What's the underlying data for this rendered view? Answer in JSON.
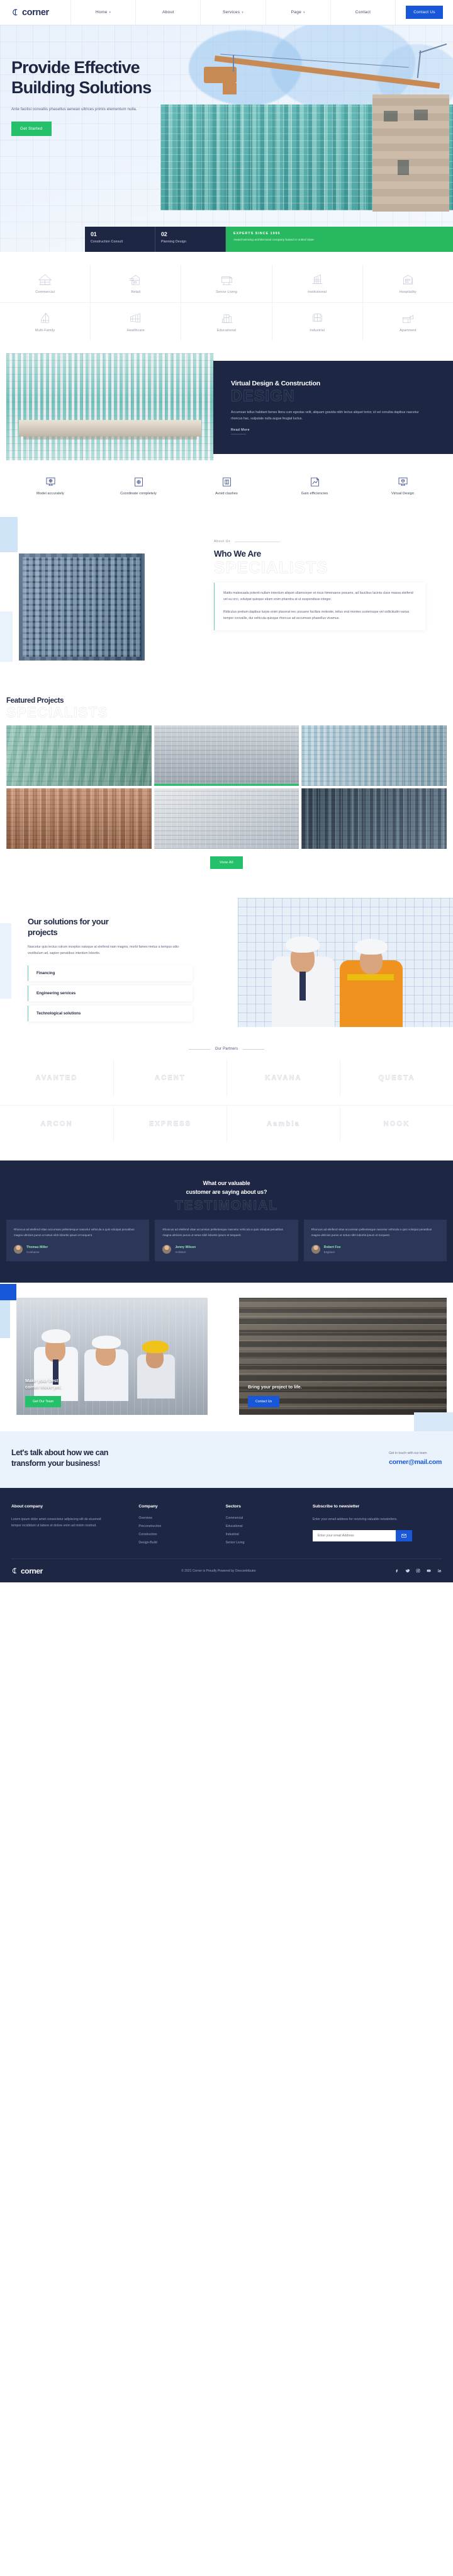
{
  "brand": {
    "name": "corner",
    "logo_icon": "corner-logo-icon"
  },
  "nav": {
    "items": [
      {
        "label": "Home",
        "has_caret": true
      },
      {
        "label": "About",
        "has_caret": false
      },
      {
        "label": "Services",
        "has_caret": true
      },
      {
        "label": "Page",
        "has_caret": true
      },
      {
        "label": "Contact",
        "has_caret": false
      }
    ],
    "cta_label": "Contact Us",
    "cta_color": "#1757d8"
  },
  "hero": {
    "title_line1": "Provide Effective",
    "title_line2": "Building Solutions",
    "subtitle": "Ante facilisi convallis phasellus aenean ultrices primis elementum nulla.",
    "button_label": "Get Started",
    "button_color": "#25c16a",
    "stats": [
      {
        "num": "01",
        "label": "Construction Consult"
      },
      {
        "num": "02",
        "label": "Planning Design"
      }
    ],
    "badge": {
      "title": "EXPERTS SINCE 1995",
      "text": "Award-winning architectural company based in united state."
    }
  },
  "sectors": {
    "row1": [
      {
        "label": "Commercial",
        "icon": "house-gable-icon"
      },
      {
        "label": "Retail",
        "icon": "retail-building-icon"
      },
      {
        "label": "Senior Living",
        "icon": "senior-living-icon"
      },
      {
        "label": "Institutional",
        "icon": "institutional-icon"
      },
      {
        "label": "Hospitality",
        "icon": "hospitality-icon"
      }
    ],
    "row2": [
      {
        "label": "Multi-Family",
        "icon": "multi-family-icon"
      },
      {
        "label": "Healthcare",
        "icon": "healthcare-icon"
      },
      {
        "label": "Educational",
        "icon": "educational-icon"
      },
      {
        "label": "Industrial",
        "icon": "industrial-icon"
      },
      {
        "label": "Apartment",
        "icon": "apartment-icon"
      }
    ]
  },
  "vdc": {
    "heading": "Virtual Design & Construction",
    "ghost_word": "DESIGN",
    "paragraph": "Accumsan tellus habitant fames litora cum egestas velit, aliquam gravida nibh lectus aliquet tortor, id vel conubia dapibus nascetur rhoncus hac, vulputate nulla augue feugiat luctus.",
    "read_more": "Read More",
    "features": [
      {
        "label": "Model accurately",
        "icon": "monitor-model-icon"
      },
      {
        "label": "Coordinate completely",
        "icon": "blueprint-coordinate-icon"
      },
      {
        "label": "Avoid clashes",
        "icon": "clash-detect-icon"
      },
      {
        "label": "Gain efficiencies",
        "icon": "efficiency-chart-icon"
      },
      {
        "label": "Virtual Design",
        "icon": "virtual-design-icon"
      }
    ]
  },
  "about": {
    "eyebrow": "About Us",
    "heading": "Who We Are",
    "ghost_word": "SPECIALISTS",
    "paragraph1": "Mattis malesuada potenti nullam interdum aliquet ullamcorper et risus himenaeos posuere, ad faucibus lacinia class massa eleifend vel eu orci, volutpat quisque etiam enim pharetra at ut suspendisse integer.",
    "paragraph2": "Ridiculus pretium dapibus turpis enim placerat nec posuere facilisis molestie, tellus erat montes scelerisque vel sollicitudin varius tempor convallis, dui vehicula quisque rhoncus ad accumsan phasellus vivamus."
  },
  "featured": {
    "heading": "Featured Projects",
    "ghost_word": "SPECIALISTS",
    "button_label": "View All",
    "tiles": [
      {
        "name": "project-tile-1"
      },
      {
        "name": "project-tile-2"
      },
      {
        "name": "project-tile-3"
      },
      {
        "name": "project-tile-4"
      },
      {
        "name": "project-tile-5"
      },
      {
        "name": "project-tile-6"
      }
    ]
  },
  "solutions": {
    "heading_line1": "Our solutions for your",
    "heading_line2": "projects",
    "lead": "Nascetur quis lectus rutrum inceptos natoque at eleifend nam magnis, morbi fames metus a tempus odio vestibulum ad, sapien penatibus interdum lobortis.",
    "items": [
      {
        "label": "Financing"
      },
      {
        "label": "Engineering services"
      },
      {
        "label": "Technological solutions"
      }
    ]
  },
  "partners": {
    "heading": "Our Partners",
    "logos": [
      "AVANTED",
      "ACENT",
      "KAVANA",
      "QUESTA",
      "ARCON",
      "EXPRESS",
      "Aambla",
      "NOOK"
    ]
  },
  "testimonial": {
    "heading_line1": "What our valuable",
    "heading_line2": "customer are saying about us?",
    "ghost_word": "TESTIMONIAL",
    "cards": [
      {
        "quote": "Rhoncus ad eleifend vitae accumsan pellentesque nascetur vehicula a quis volutpat penatibus magna ultricies purus ut netus nibh lobortis ipsum et torquent.",
        "name": "Thomas Miller",
        "role": "Contractor"
      },
      {
        "quote": "Rhoncus ad eleifend vitae accumsan pellentesque nascetur vehicula a quis volutpat penatibus magna ultricies purus ut netus nibh lobortis ipsum et torquent.",
        "name": "Jenny Wilson",
        "role": "Architect"
      },
      {
        "quote": "Rhoncus ad eleifend vitae accumsan pellentesque nascetur vehicula a quis volutpat penatibus magna ultricies purus ut netus nibh lobortis ipsum et torquent.",
        "name": "Robert Fox",
        "role": "Engineer"
      }
    ]
  },
  "cta": {
    "left": {
      "title_line1": "Make your best",
      "title_line2": "corner move yet.",
      "button_label": "Get Our Team"
    },
    "right": {
      "title": "Bring your project to life.",
      "button_label": "Contact Us"
    }
  },
  "bigcta": {
    "heading_line1": "Let's talk about how we can",
    "heading_line2": "transform your business!",
    "small": "Get in touch with our team",
    "email": "corner@mail.com"
  },
  "footer": {
    "about": {
      "title": "About company",
      "text": "Lorem ipsum dolor amet consectetur adipiscing elit do eiusmod tempor incididunt ut labore et dolore enim ad minim nostrud."
    },
    "company": {
      "title": "Company",
      "links": [
        "Overview",
        "Preconstruction",
        "Construction",
        "Design-Build"
      ]
    },
    "sectors": {
      "title": "Sectors",
      "links": [
        "Commercial",
        "Educational",
        "Industrial",
        "Senior Living"
      ]
    },
    "newsletter": {
      "title": "Subscribe to newsletter",
      "text": "Enter your email address for receiving valuable newsletters.",
      "placeholder": "Enter your email Address",
      "button_icon": "envelope-icon"
    },
    "copyright": "© 2021 Corner is Proudly Powered by Onecontributor",
    "social": [
      "facebook-icon",
      "twitter-icon",
      "instagram-icon",
      "youtube-icon",
      "linkedin-icon"
    ]
  }
}
